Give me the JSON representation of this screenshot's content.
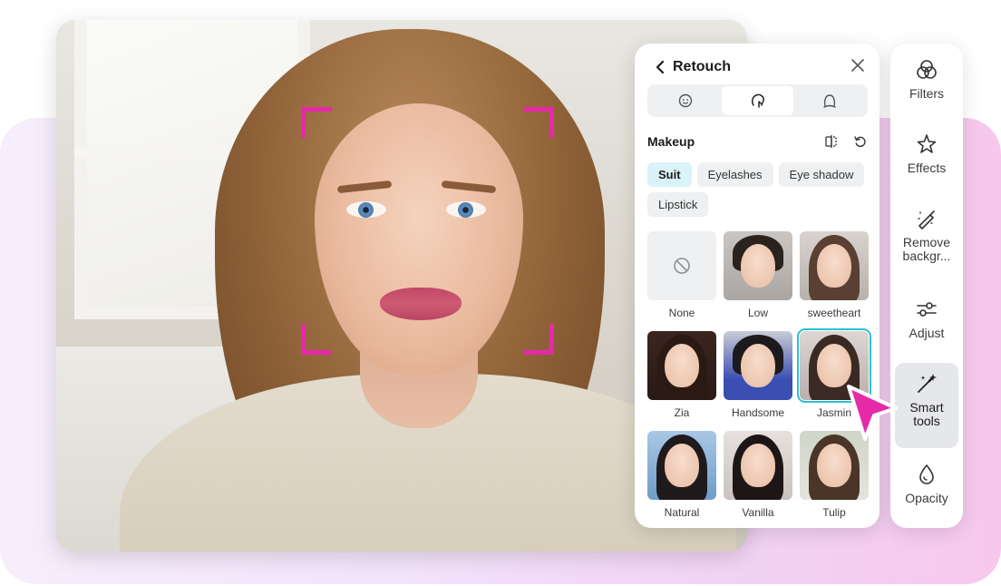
{
  "panel": {
    "title": "Retouch",
    "segments": [
      {
        "icon": "face-icon"
      },
      {
        "icon": "head-touch-icon"
      },
      {
        "icon": "body-icon"
      }
    ],
    "section_title": "Makeup",
    "chips": [
      {
        "label": "Suit",
        "active": true
      },
      {
        "label": "Eyelashes",
        "active": false
      },
      {
        "label": "Eye shadow",
        "active": false
      },
      {
        "label": "Lipstick",
        "active": false
      }
    ],
    "presets": [
      {
        "label": "None"
      },
      {
        "label": "Low"
      },
      {
        "label": "sweetheart"
      },
      {
        "label": "Zia"
      },
      {
        "label": "Handsome"
      },
      {
        "label": "Jasmin",
        "selected": true
      },
      {
        "label": "Natural"
      },
      {
        "label": "Vanilla"
      },
      {
        "label": "Tulip"
      }
    ]
  },
  "rail": {
    "items": [
      {
        "label": "Filters",
        "icon": "filters-icon"
      },
      {
        "label": "Effects",
        "icon": "effects-icon"
      },
      {
        "label": "Remove backgr...",
        "icon": "remove-background-icon"
      },
      {
        "label": "Adjust",
        "icon": "adjust-icon"
      },
      {
        "label": "Smart tools",
        "icon": "smart-tools-icon",
        "active": true
      },
      {
        "label": "Opacity",
        "icon": "opacity-icon"
      }
    ]
  },
  "colors": {
    "accent_pink": "#e52aa8",
    "selection_cyan": "#29c1d4",
    "chip_active_bg": "#d9f3f8"
  }
}
